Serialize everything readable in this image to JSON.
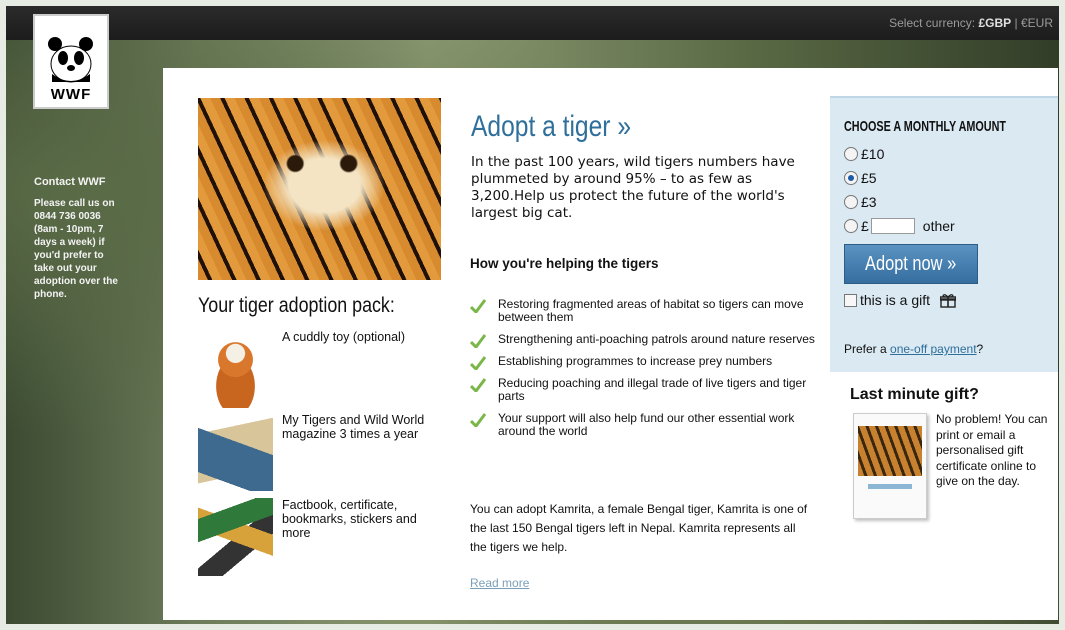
{
  "topbar": {
    "currency_label": "Select currency:",
    "currency_selected": "£GBP",
    "currency_separator": " | ",
    "currency_other": "€EUR"
  },
  "logo": {
    "text": "WWF"
  },
  "contact": {
    "title": "Contact WWF",
    "body": "Please call us on 0844 736 0036 (8am - 10pm, 7 days a week) if you'd prefer to take out your adoption over the phone."
  },
  "pack": {
    "title": "Your tiger adoption pack:",
    "items": [
      {
        "icon": "tiger-toy",
        "text": "A cuddly toy (optional)"
      },
      {
        "icon": "magazine",
        "text": "My Tigers and Wild World magazine 3 times a year"
      },
      {
        "icon": "factbook",
        "text": "Factbook, certificate, bookmarks, stickers and more"
      }
    ]
  },
  "main": {
    "title": "Adopt a tiger »",
    "intro": "In the past 100 years, wild tigers numbers have plummeted by around 95% – to as few as 3,200.Help us protect the future of the world's largest big cat.",
    "helping_title": "How you're helping the tigers",
    "benefits": [
      "Restoring fragmented areas of habitat so tigers can move between them",
      "Strengthening anti-poaching patrols around nature reserves",
      "Establishing programmes to increase prey numbers",
      "Reducing poaching and illegal trade of live tigers and tiger parts",
      "Your support will also help fund our other essential work around the world"
    ],
    "kamrita": "You can adopt Kamrita, a female Bengal tiger, Kamrita is one of the last 150 Bengal tigers left in Nepal. Kamrita represents all the tigers we help.",
    "read_more": "Read more"
  },
  "amount": {
    "title": "CHOOSE A MONTHLY AMOUNT",
    "options": [
      {
        "label": "£10",
        "selected": false
      },
      {
        "label": "£5",
        "selected": true
      },
      {
        "label": "£3",
        "selected": false
      }
    ],
    "other_prefix": "£",
    "other_value": "",
    "other_label": "other",
    "adopt_button": "Adopt now »",
    "gift_label": "this is a gift",
    "one_off_prefix": "Prefer a ",
    "one_off_link": "one-off payment",
    "one_off_suffix": "?"
  },
  "last_minute": {
    "title": "Last minute gift?",
    "text": "No problem! You can print or email a personalised gift certificate online to give on the day."
  },
  "colors": {
    "accent": "#2e6f9b",
    "button": "#356e9f",
    "check": "#7ab648",
    "amount_bg": "#dbe9f2"
  }
}
